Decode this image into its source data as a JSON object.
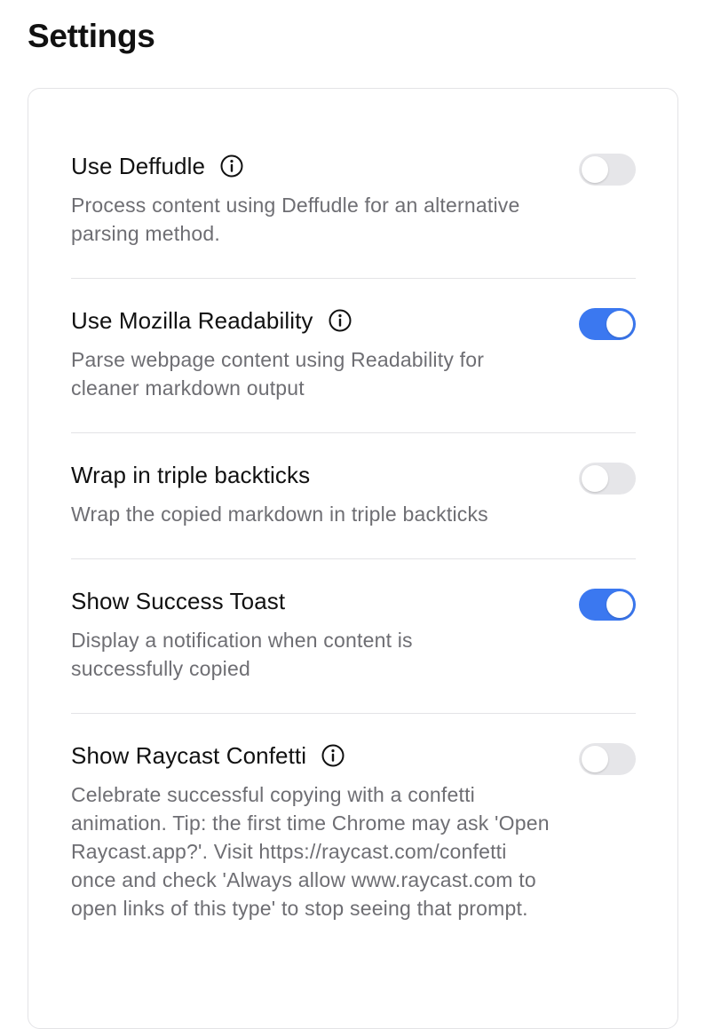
{
  "page": {
    "title": "Settings"
  },
  "colors": {
    "toggle_on": "#3b78f0",
    "toggle_off": "#e6e6e9",
    "description": "#6e6e73"
  },
  "settings": [
    {
      "label": "Use Deffudle",
      "has_info_icon": true,
      "icon": "info-icon",
      "description": "Process content using Deffudle for an alternative parsing method.",
      "enabled": false
    },
    {
      "label": "Use Mozilla Readability",
      "has_info_icon": true,
      "icon": "info-icon",
      "description": "Parse webpage content using Readability for cleaner markdown output",
      "enabled": true
    },
    {
      "label": "Wrap in triple backticks",
      "has_info_icon": false,
      "description": "Wrap the copied markdown in triple backticks",
      "enabled": false
    },
    {
      "label": "Show Success Toast",
      "has_info_icon": false,
      "description": "Display a notification when content is successfully copied",
      "enabled": true
    },
    {
      "label": "Show Raycast Confetti",
      "has_info_icon": true,
      "icon": "info-icon",
      "description": "Celebrate successful copying with a confetti animation. Tip: the first time Chrome may ask 'Open Raycast.app?'. Visit https://raycast.com/confetti once and check 'Always allow www.raycast.com to open links of this type' to stop seeing that prompt.",
      "enabled": false
    }
  ]
}
